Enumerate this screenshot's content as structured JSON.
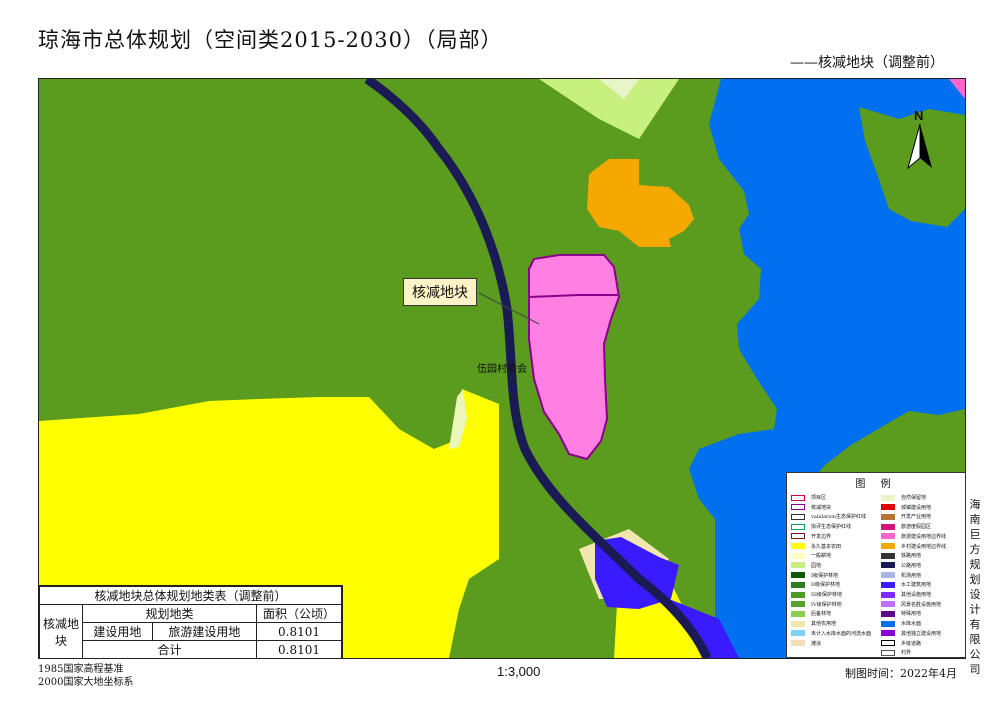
{
  "title": "琼海市总体规划（空间类2015-2030）（局部）",
  "subtitle": "——核减地块（调整前）",
  "map": {
    "callout": "核减地块",
    "village": "伍园村委会",
    "north": "N",
    "scale": "1:3,000"
  },
  "legend": {
    "title": "图 例",
    "left": [
      {
        "label": "项目区",
        "color": "#ffffff",
        "border": "#d4003a"
      },
      {
        "label": "核减地块",
        "color": "#ffffff",
        "border": "#8b008b"
      },
      {
        "label": "validation生态保护红线",
        "color": "#ffffff",
        "border": "#333333"
      },
      {
        "label": "拟评生态保护红线",
        "color": "#ffffff",
        "border": "#00a060"
      },
      {
        "label": "开发边界",
        "color": "#ffffff",
        "border": "#7a1a1a"
      },
      {
        "label": "永久基本农田",
        "color": "#ffff00",
        "border": "#ffff00"
      },
      {
        "label": "一般耕地",
        "color": "#ffffc0",
        "border": "#ffffc0"
      },
      {
        "label": "园地",
        "color": "#c8f080",
        "border": "#c8f080"
      },
      {
        "label": "I级保护林地",
        "color": "#0a5a0a",
        "border": "#0a5a0a"
      },
      {
        "label": "II级保护林地",
        "color": "#2e7d1e",
        "border": "#2e7d1e"
      },
      {
        "label": "III级保护林地",
        "color": "#4f9a22",
        "border": "#4f9a22"
      },
      {
        "label": "IV级保护林地",
        "color": "#5aa02c",
        "border": "#5aa02c"
      },
      {
        "label": "后备林地",
        "color": "#8ccf50",
        "border": "#8ccf50"
      },
      {
        "label": "其他农用地",
        "color": "#f2e6b0",
        "border": "#f2e6b0"
      },
      {
        "label": "未计入水库水面的河流水面",
        "color": "#7fd0f5",
        "border": "#7fd0f5"
      },
      {
        "label": "滩涂",
        "color": "#f5deb3",
        "border": "#f5deb3"
      }
    ],
    "right": [
      {
        "label": "自然保留地",
        "color": "#e8f5c8",
        "border": "#e8f5c8"
      },
      {
        "label": "城镇建设用地",
        "color": "#e00000",
        "border": "#e00000"
      },
      {
        "label": "开发产业用地",
        "color": "#b87333",
        "border": "#b87333"
      },
      {
        "label": "旅游度假园区",
        "color": "#d4147c",
        "border": "#d4147c"
      },
      {
        "label": "旅游建设用地边界线",
        "color": "#ff66cc",
        "border": "#ff66cc"
      },
      {
        "label": "乡村建设用地边界线",
        "color": "#f5a800",
        "border": "#f5a800"
      },
      {
        "label": "铁路用地",
        "color": "#333333",
        "border": "#333333"
      },
      {
        "label": "公路用地",
        "color": "#1a1a55",
        "border": "#1a1a55"
      },
      {
        "label": "机场用地",
        "color": "#aab4e6",
        "border": "#aab4e6"
      },
      {
        "label": "水工建筑用地",
        "color": "#3a1aff",
        "border": "#3a1aff"
      },
      {
        "label": "其他设施用地",
        "color": "#7f2aff",
        "border": "#7f2aff"
      },
      {
        "label": "风景名胜设施用地",
        "color": "#c070ff",
        "border": "#c070ff"
      },
      {
        "label": "特殊用地",
        "color": "#5a0a8a",
        "border": "#5a0a8a"
      },
      {
        "label": "水库水面",
        "color": "#0070f0",
        "border": "#0070f0"
      },
      {
        "label": "其他独立建设用地",
        "color": "#8a00d4",
        "border": "#8a00d4"
      },
      {
        "label": "乡级道路",
        "color": "#ffffff",
        "border": "#000000"
      },
      {
        "label": "村界",
        "color": "#ffffff",
        "border": "#555555"
      }
    ]
  },
  "company": "海南巨方规划设计有限公司",
  "table": {
    "title": "核减地块总体规划地类表（调整前）",
    "row_header": "核减地块",
    "col_category": "规划地类",
    "col_area": "面积（公顷）",
    "rows": [
      {
        "category": "建设用地",
        "subcategory": "旅游建设用地",
        "area": "0.8101"
      }
    ],
    "total_label": "合计",
    "total_area": "0.8101"
  },
  "datum": [
    "1985国家高程基准",
    "2000国家大地坐标系"
  ],
  "date": "制图时间：2022年4月"
}
